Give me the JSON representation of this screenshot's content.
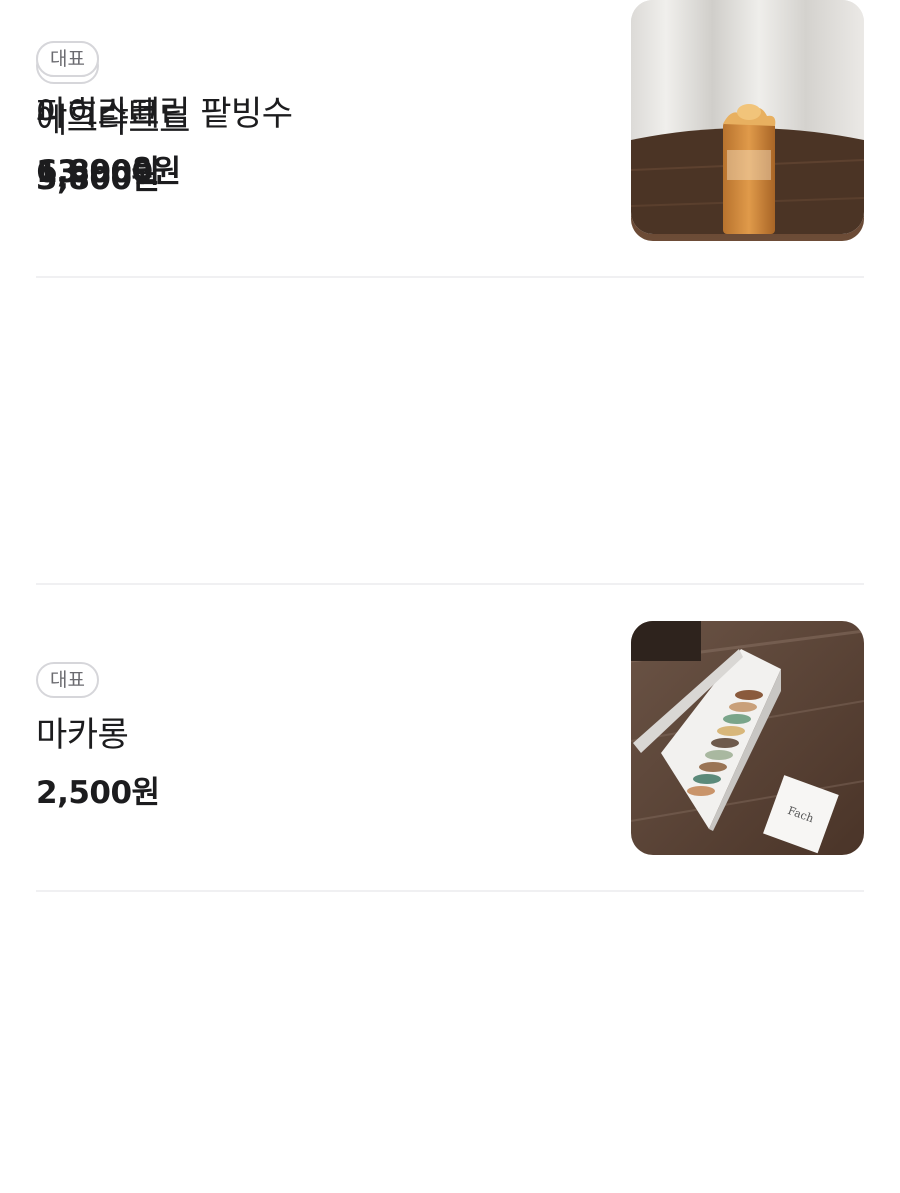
{
  "menu": {
    "items": [
      {
        "badge": "대표",
        "name": "에그타르트",
        "price": "3,800원",
        "image_icon": "egg-tart-photo"
      },
      {
        "badge": "대표",
        "name": "마카롱",
        "price": "2,500원",
        "image_icon": "macaron-box-photo",
        "image_card_text": "Fach"
      },
      {
        "badge": "대표",
        "name": "아이스크림 팥빙수",
        "price": "13,900원",
        "image_icon": "patbingsu-photo"
      },
      {
        "badge": "대표",
        "name": "파흐라떼",
        "price": "6,800원",
        "image_icon": "latte-photo"
      }
    ]
  },
  "colors": {
    "text": "#1c1c1e",
    "badge_border": "#d6d6da",
    "badge_text": "#6b6b70",
    "divider": "#f0f0f2",
    "table_wood": "#5a3f2c"
  }
}
